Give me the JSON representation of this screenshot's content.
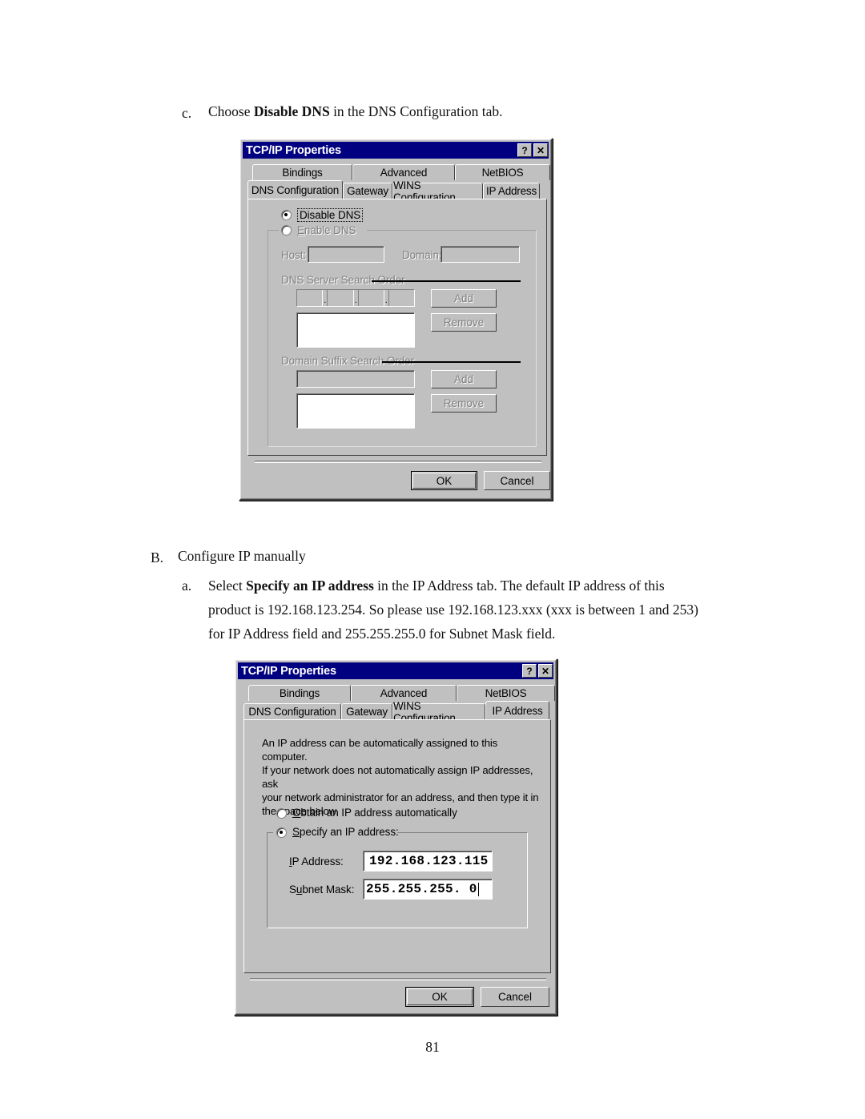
{
  "document": {
    "step_c": {
      "marker": "c.",
      "text_before": "Choose ",
      "bold": "Disable DNS",
      "text_after": " in the DNS Configuration tab."
    },
    "section_b": {
      "marker": "B.",
      "text": "Configure IP manually"
    },
    "step_a": {
      "marker": "a.",
      "line1_before": "Select ",
      "line1_bold": "Specify an IP address",
      "line1_after": " in the IP Address tab. The default IP address of this",
      "line2": "product is 192.168.123.254. So please use 192.168.123.xxx (xxx is between 1 and 253)",
      "line3": "for IP Address field and 255.255.255.0 for Subnet Mask field."
    },
    "page_number": "81"
  },
  "dialog_dns": {
    "title": "TCP/IP Properties",
    "titlebar_buttons": [
      {
        "name": "help-button",
        "glyph": "?"
      },
      {
        "name": "close-button",
        "glyph": "✕"
      }
    ],
    "tabs_row1": [
      {
        "label": "Bindings",
        "active": false
      },
      {
        "label": "Advanced",
        "active": false
      },
      {
        "label": "NetBIOS",
        "active": false
      }
    ],
    "tabs_row2": [
      {
        "label": "DNS Configuration",
        "active": true
      },
      {
        "label": "Gateway",
        "active": false
      },
      {
        "label": "WINS Configuration",
        "active": false
      },
      {
        "label": "IP Address",
        "active": false
      }
    ],
    "radio_disable": {
      "label": "Disable DNS",
      "checked": true
    },
    "radio_enable": {
      "label": "Enable DNS",
      "checked": false
    },
    "host_label": "Host:",
    "host_value": "",
    "domain_label": "Domain:",
    "domain_value": "",
    "dns_search_title": "DNS Server Search Order",
    "dns_add": "Add",
    "dns_remove": "Remove",
    "dns_ip_value": "",
    "dns_list_value": "",
    "suffix_search_title": "Domain Suffix Search Order",
    "suffix_input_value": "",
    "suffix_add": "Add",
    "suffix_remove": "Remove",
    "suffix_list_value": "",
    "ok": "OK",
    "cancel": "Cancel"
  },
  "dialog_ip": {
    "title": "TCP/IP Properties",
    "titlebar_buttons": [
      {
        "name": "help-button",
        "glyph": "?"
      },
      {
        "name": "close-button",
        "glyph": "✕"
      }
    ],
    "tabs_row1": [
      {
        "label": "Bindings",
        "active": false
      },
      {
        "label": "Advanced",
        "active": false
      },
      {
        "label": "NetBIOS",
        "active": false
      }
    ],
    "tabs_row2": [
      {
        "label": "DNS Configuration",
        "active": false
      },
      {
        "label": "Gateway",
        "active": false
      },
      {
        "label": "WINS Configuration",
        "active": false
      },
      {
        "label": "IP Address",
        "active": true
      }
    ],
    "description": "An IP address can be automatically assigned to this computer.\nIf your network does not automatically assign IP addresses, ask\nyour network administrator for an address, and then type it in\nthe space below.",
    "radio_obtain": {
      "label": "Obtain an IP address automatically",
      "checked": false
    },
    "radio_specify": {
      "label": "Specify an IP address:",
      "checked": true
    },
    "ip_address_label": "IP Address:",
    "ip_address_value": "192.168.123.115",
    "subnet_mask_label": "Subnet Mask:",
    "subnet_mask_value": "255.255.255.  0",
    "ok": "OK",
    "cancel": "Cancel"
  },
  "colors": {
    "titlebar": "#000080",
    "face": "#c0c0c0",
    "shadow": "#808080",
    "dark": "#404040",
    "light": "#ffffff",
    "text": "#000000"
  }
}
